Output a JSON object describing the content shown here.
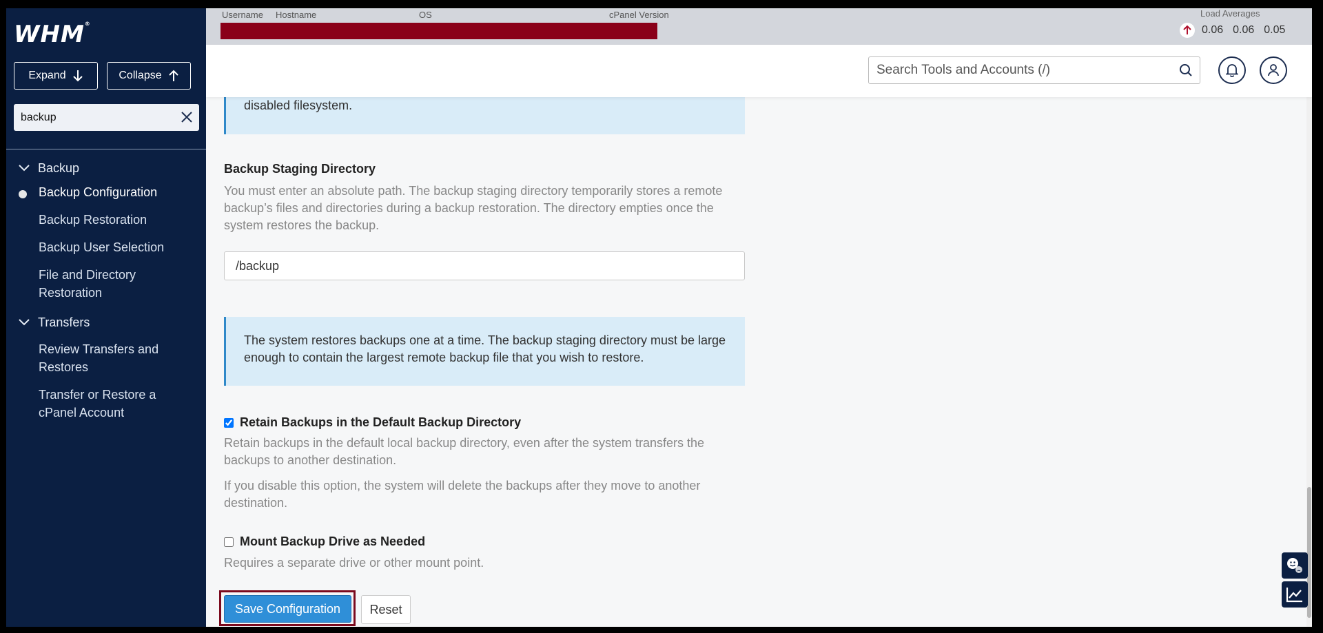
{
  "sidebar": {
    "logo": "WHM",
    "expand_label": "Expand",
    "collapse_label": "Collapse",
    "search_value": "backup",
    "groups": [
      {
        "label": "Backup",
        "items": [
          "Backup Configuration",
          "Backup Restoration",
          "Backup User Selection",
          "File and Directory Restoration"
        ]
      },
      {
        "label": "Transfers",
        "items": [
          "Review Transfers and Restores",
          "Transfer or Restore a cPanel Account"
        ]
      }
    ],
    "active_item": "Backup Configuration"
  },
  "topbar": {
    "labels": [
      "Username",
      "Hostname",
      "OS",
      "cPanel Version"
    ],
    "load_title": "Load Averages",
    "load_values": [
      "0.06",
      "0.06",
      "0.05"
    ]
  },
  "header": {
    "search_placeholder": "Search Tools and Accounts (/)"
  },
  "content": {
    "note_top_tail": "disabled filesystem.",
    "staging_title": "Backup Staging Directory",
    "staging_desc": "You must enter an absolute path. The backup staging directory temporarily stores a remote backup’s files and directories during a backup restoration. The directory empties once the system restores the backup.",
    "staging_value": "/backup",
    "staging_note": "The system restores backups one at a time. The backup staging directory must be large enough to contain the largest remote backup file that you wish to restore.",
    "retain_label": "Retain Backups in the Default Backup Directory",
    "retain_checked": true,
    "retain_desc1": "Retain backups in the default local backup directory, even after the system transfers the backups to another destination.",
    "retain_desc2": "If you disable this option, the system will delete the backups after they move to another destination.",
    "mount_label": "Mount Backup Drive as Needed",
    "mount_checked": false,
    "mount_desc": "Requires a separate drive or other mount point.",
    "save_label": "Save Configuration",
    "reset_label": "Reset"
  },
  "colors": {
    "sidebar_bg": "#0b1f42",
    "accent": "#2f8fd8",
    "note_bg": "#d9ecf8",
    "redbar": "#8a0019"
  }
}
